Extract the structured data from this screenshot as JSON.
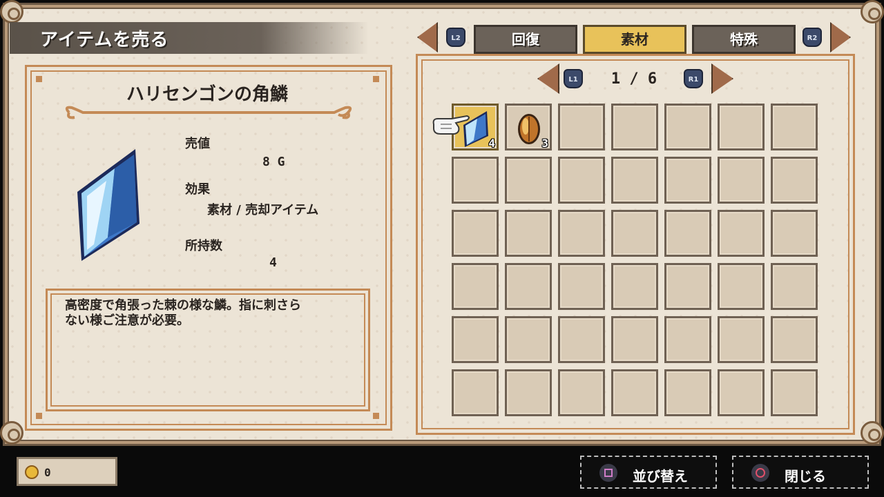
{
  "header": {
    "title": "アイテムを売る"
  },
  "tabs": {
    "left_badge": "L2",
    "right_badge": "R2",
    "items": [
      {
        "label": "回復",
        "active": false
      },
      {
        "label": "素材",
        "active": true
      },
      {
        "label": "特殊",
        "active": false
      }
    ]
  },
  "pager": {
    "left_badge": "L1",
    "right_badge": "R1",
    "text": "1 / 6"
  },
  "detail": {
    "name": "ハリセンゴンの角鱗",
    "price_label": "売値",
    "price_value": "8 G",
    "effect_label": "効果",
    "effect_value": "素材 / 売却アイテム",
    "owned_label": "所持数",
    "owned_value": "4",
    "description_line1": "高密度で角張った棘の様な鱗。指に刺さら",
    "description_line2": "ない様ご注意が必要。"
  },
  "inventory": {
    "slots": [
      {
        "icon": "blue-scale-icon",
        "count": "4",
        "selected": true
      },
      {
        "icon": "amber-seed-icon",
        "count": "3",
        "selected": false
      }
    ]
  },
  "footer": {
    "gold": "0",
    "sort_label": "並び替え",
    "close_label": "閉じる"
  },
  "colors": {
    "panel_bg": "#ece4d6",
    "frame_brown": "#c48a56",
    "tab_active": "#e8c25a",
    "tab_inactive": "#6b6259",
    "badge_blue": "#3c4a6a"
  }
}
